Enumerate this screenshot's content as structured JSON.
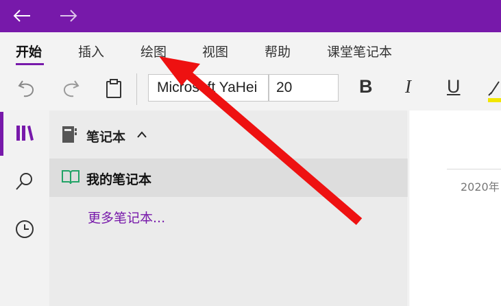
{
  "titlebar": {
    "back_icon": "arrow-left-icon",
    "forward_icon": "arrow-right-icon",
    "color": "#7719aa"
  },
  "ribbon": {
    "tabs": [
      {
        "label": "开始",
        "active": true
      },
      {
        "label": "插入"
      },
      {
        "label": "绘图"
      },
      {
        "label": "视图"
      },
      {
        "label": "帮助"
      },
      {
        "label": "课堂笔记本"
      }
    ]
  },
  "toolbar": {
    "undo_icon": "undo-icon",
    "redo_icon": "redo-icon",
    "paste_icon": "clipboard-icon",
    "font_name": "Microsoft YaHei",
    "font_size": "20",
    "bold": "B",
    "italic": "I",
    "underline": "U",
    "highlight_icon": "highlighter-icon",
    "highlight_color": "#f2e600"
  },
  "leftrail": {
    "items": [
      "notebooks-icon",
      "search-icon",
      "clock-icon"
    ],
    "accent": "#7719aa"
  },
  "notebooks": {
    "header": "笔记本",
    "current": "我的笔记本",
    "more": "更多笔记本...",
    "notebook_icon_color": "#21a366"
  },
  "page": {
    "date": "2020年"
  },
  "annotation": {
    "arrow_color": "#ee1111",
    "arrow_target": "绘图"
  }
}
